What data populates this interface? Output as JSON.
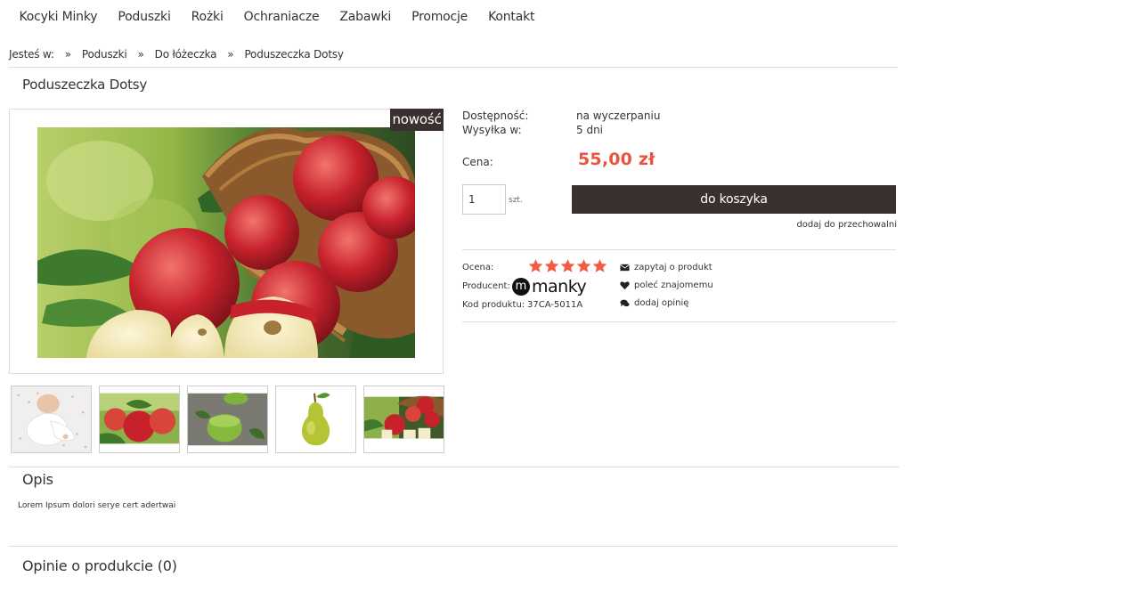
{
  "nav": {
    "items": [
      "Kocyki Minky",
      "Poduszki",
      "Rożki",
      "Ochraniacze",
      "Zabawki",
      "Promocje",
      "Kontakt"
    ]
  },
  "breadcrumb": {
    "prefix": "Jesteś w:",
    "separator": "»",
    "items": [
      "Poduszki",
      "Do łóżeczka",
      "Poduszeczka Dotsy"
    ]
  },
  "product": {
    "title": "Poduszeczka Dotsy",
    "badge": "nowość",
    "availability_label": "Dostępność:",
    "availability_value": "na wyczerpaniu",
    "shipping_label": "Wysyłka w:",
    "shipping_value": "5 dni",
    "price_label": "Cena:",
    "price": "55,00 zł",
    "qty_value": "1",
    "qty_unit": "szt.",
    "add_to_cart": "do koszyka",
    "add_to_storage": "dodaj do przechowalni",
    "rating_label": "Ocena:",
    "rating": 5,
    "rating_max": 5,
    "producer_label": "Producent:",
    "producer_logo_text": "manky",
    "producer_logo_letter": "m",
    "code_label": "Kod produktu:",
    "code_value": "37CA-5011A"
  },
  "actions": {
    "ask": "zapytaj o produkt",
    "recommend": "poleć znajomemu",
    "review": "dodaj opinię"
  },
  "thumbnails": [
    "baby-thumbnail",
    "apples-thumbnail",
    "smoothie-thumbnail",
    "pear-thumbnail",
    "apples-basket-thumbnail"
  ],
  "description": {
    "title": "Opis",
    "text": "Lorem Ipsum dolori serye cert adertwai"
  },
  "reviews": {
    "title": "Opinie o produkcie (0)"
  },
  "colors": {
    "accent": "#e8553f",
    "dark": "#3a3030",
    "star": "#f25c45"
  }
}
